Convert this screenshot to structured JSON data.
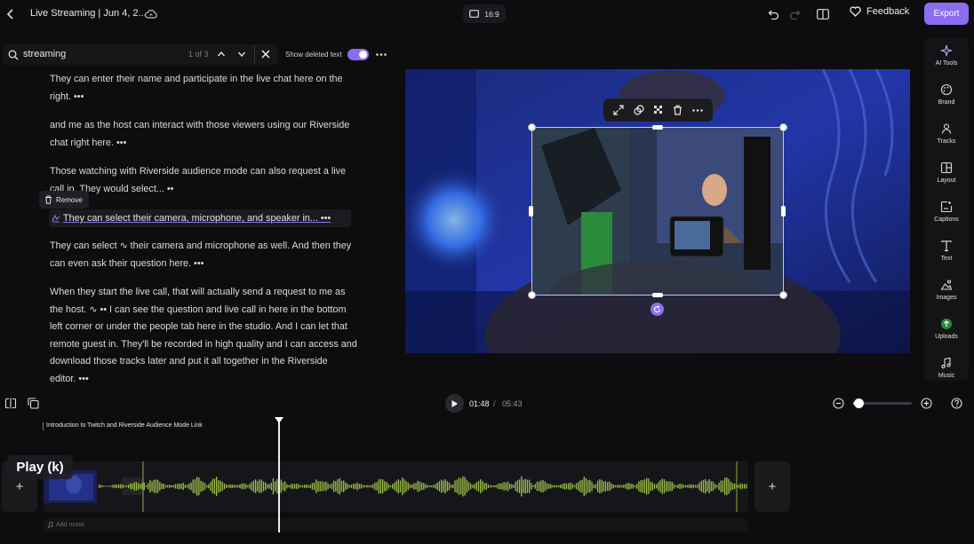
{
  "header": {
    "title": "Live Streaming | Jun 4, 2...",
    "aspect_ratio": "16:9",
    "feedback_label": "Feedback",
    "export_label": "Export",
    "icons": [
      "back-chevron-icon",
      "cloud-sync-icon",
      "screen-icon",
      "undo-icon",
      "redo-icon",
      "layout-toggle-icon",
      "heart-icon"
    ]
  },
  "search": {
    "query": "streaming",
    "match_count": "1 of 3",
    "show_deleted_label": "Show deleted text",
    "show_deleted_on": true
  },
  "transcript": {
    "remove_label": "Remove",
    "paragraphs": [
      {
        "line1": "They can enter their name and participate in the live chat here on the",
        "line2": "right. •••"
      },
      {
        "line1": "and me as the host can interact with those viewers using our Riverside",
        "line2": "chat right here. •••"
      },
      {
        "line1": "Those watching with Riverside audience mode can also request a live",
        "line2": "call in. They would select... ••"
      },
      {
        "line1": "They can select their camera, microphone, and speaker in... •••"
      },
      {
        "line1": "They can select ∿ their camera and microphone as well. And then they",
        "line2": "can even ask their question here. •••"
      },
      {
        "line1": "When they start the live call, that will actually send a request to me as",
        "line2": "the host. ∿ •• I can see the question and live call in here in the bottom",
        "line3": "left corner or under the people tab here in the studio. And I can let that",
        "line4": "remote guest in. They'll be recorded in high quality and I can access and",
        "line5": "download those tracks later and put it all together in the Riverside",
        "line6": "editor. •••"
      }
    ]
  },
  "overlay_toolbar": {
    "icons": [
      "expand-icon",
      "swap-layer-icon",
      "transparency-icon",
      "trash-icon",
      "more-icon"
    ]
  },
  "sidebar": {
    "items": [
      {
        "label": "AI Tools",
        "icon": "sparkles-icon"
      },
      {
        "label": "Brand",
        "icon": "palette-icon"
      },
      {
        "label": "Tracks",
        "icon": "people-icon"
      },
      {
        "label": "Layout",
        "icon": "layout-grid-icon"
      },
      {
        "label": "Captions",
        "icon": "captions-icon"
      },
      {
        "label": "Text",
        "icon": "text-icon"
      },
      {
        "label": "Images",
        "icon": "image-icon"
      },
      {
        "label": "Uploads",
        "icon": "upload-icon"
      },
      {
        "label": "Music",
        "icon": "music-note-icon"
      }
    ]
  },
  "playback": {
    "current_time": "01:48",
    "separator": "/",
    "total_time": "05:43",
    "zoom_level": 0.06
  },
  "timeline": {
    "clip_title": "Introduction to Twitch and Riverside Audience Mode Link",
    "tooltip": "Play (k)",
    "add_music_label": "Add music",
    "add_symbol": "+"
  },
  "colors": {
    "accent": "#8c6df2",
    "waveform": "#9ec24a",
    "background": "#0d0d0f"
  }
}
